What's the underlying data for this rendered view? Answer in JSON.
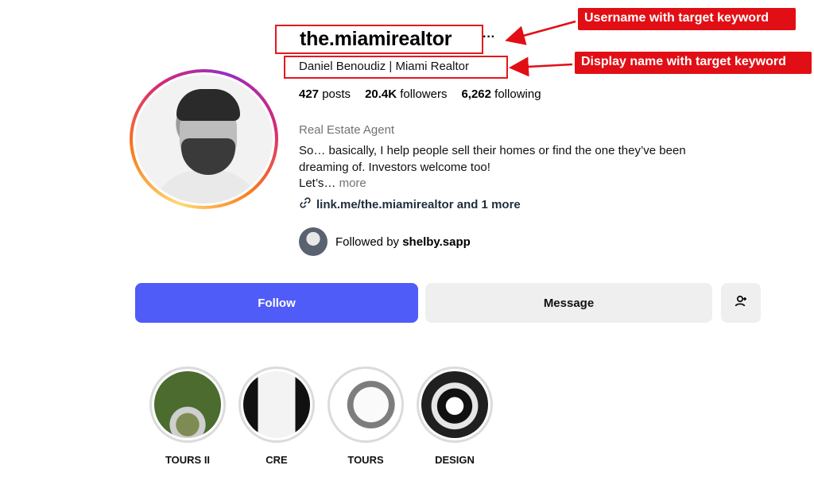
{
  "profile": {
    "username": "the.miamirealtor",
    "more_glyph": "···",
    "display_name": "Daniel Benoudiz | Miami Realtor",
    "stats": {
      "posts_value": "427",
      "posts_label": "posts",
      "followers_value": "20.4K",
      "followers_label": "followers",
      "following_value": "6,262",
      "following_label": "following"
    },
    "category": "Real Estate Agent",
    "bio_line1": "So… basically, I help people sell their homes or find the one they’ve been dreaming of. Investors welcome too!",
    "bio_line2_prefix": "Let’s…",
    "bio_more": "more",
    "link_text": "link.me/the.miamirealtor and 1 more",
    "followed_by_prefix": "Followed by",
    "followed_by_user": "shelby.sapp"
  },
  "callouts": {
    "username": "Username with target keyword",
    "display_name": "Display name with target keyword"
  },
  "actions": {
    "follow_label": "Follow",
    "message_label": "Message",
    "add_user_icon": "add-person-icon"
  },
  "highlights": [
    {
      "label": "TOURS II"
    },
    {
      "label": "CRE"
    },
    {
      "label": "TOURS"
    },
    {
      "label": "DESIGN"
    }
  ],
  "colors": {
    "callout_red": "#e10f15",
    "follow_blue": "#4f5cf8",
    "secondary_button_bg": "#efefef",
    "muted_text": "#737373"
  }
}
